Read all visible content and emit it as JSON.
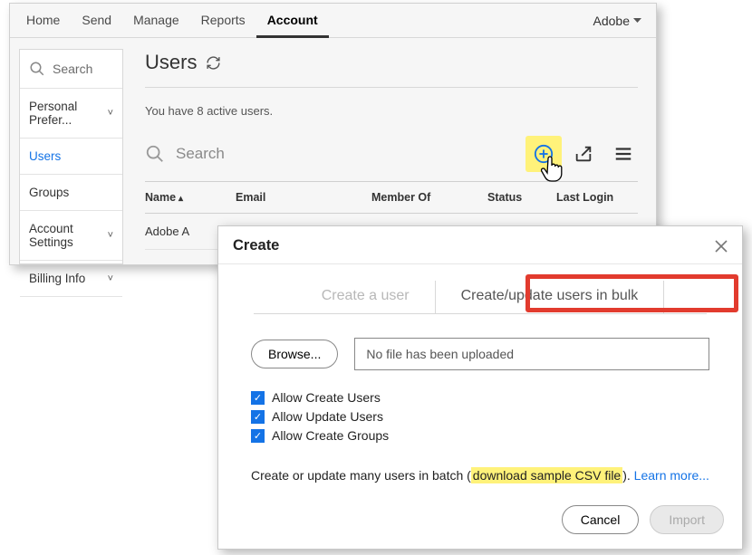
{
  "nav": {
    "items": [
      "Home",
      "Send",
      "Manage",
      "Reports",
      "Account"
    ],
    "active": "Account",
    "brand": "Adobe"
  },
  "sidebar": {
    "search": "Search",
    "items": [
      {
        "label": "Personal Prefer...",
        "chev": true
      },
      {
        "label": "Users",
        "active": true
      },
      {
        "label": "Groups"
      },
      {
        "label": "Account Settings",
        "chev": true
      },
      {
        "label": "Billing Info",
        "chev": true
      }
    ]
  },
  "page": {
    "title": "Users",
    "count_line": "You have 8 active users.",
    "search_placeholder": "Search"
  },
  "table": {
    "columns": [
      "Name",
      "Email",
      "Member Of",
      "Status",
      "Last Login"
    ],
    "rows": [
      {
        "name": "Adobe A"
      }
    ]
  },
  "modal": {
    "title": "Create",
    "tabs": [
      "Create a user",
      "Create/update users in bulk"
    ],
    "browse": "Browse...",
    "file_status": "No file has been uploaded",
    "checks": [
      "Allow Create Users",
      "Allow Update Users",
      "Allow Create Groups"
    ],
    "hint_pre": "Create or update many users in batch (",
    "hint_hl": "download sample CSV file",
    "hint_post": "). ",
    "hint_link": "Learn more...",
    "cancel": "Cancel",
    "import": "Import"
  }
}
